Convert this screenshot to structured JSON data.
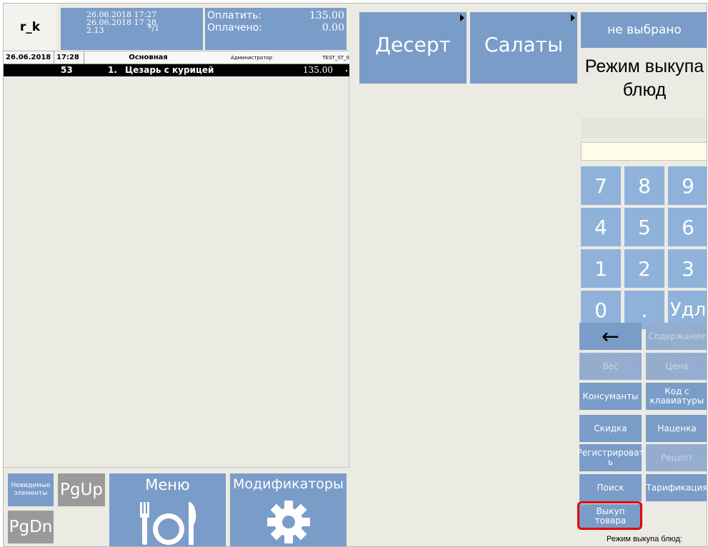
{
  "header": {
    "logo": "r_k",
    "date_open": "26.06.2018 17:27",
    "date_now": "26.06.2018 17 28",
    "version": "2.13",
    "guests": "*/1",
    "to_pay_label": "Оплатить:",
    "to_pay_value": "135.00",
    "paid_label": "Оплачено:",
    "paid_value": "0.00"
  },
  "order_header": {
    "date": "26.06.2018",
    "time": "17:28",
    "menu": "Основная",
    "user": "Администратор",
    "station": "TEST_ST_0"
  },
  "order_items": [
    {
      "code": "53",
      "num": "1.",
      "name": "Цезарь с курицей",
      "price": "135.00"
    }
  ],
  "bottom": {
    "invisible": "Невидимые элементы",
    "pgup": "PgUp",
    "pgdn": "PgDn",
    "menu": "Меню",
    "modifiers": "Модификаторы"
  },
  "categories": [
    "Десерт",
    "Салаты"
  ],
  "right": {
    "not_selected": "не выбрано",
    "mode_title": "Режим выкупа блюд",
    "input_value": "",
    "keys": [
      "7",
      "8",
      "9",
      "4",
      "5",
      "6",
      "1",
      "2",
      "3",
      "0",
      ".",
      "Удл"
    ],
    "back": "←",
    "content": "Содержание",
    "weight": "Вес",
    "price": "Цена",
    "consumers": "Консуманты",
    "code_kb": "Код с клавиатуры",
    "discount": "Скидка",
    "markup": "Наценка",
    "register": "Регистрироват ь",
    "recipe": "Рецепт",
    "search": "Поиск",
    "tariff": "Тарификация",
    "buyout": "Выкуп товара",
    "status": "Режим выкупа блюд:"
  },
  "colors": {
    "button_blue": "#7a9cc8",
    "key_blue": "#8fb2da",
    "background": "#ebeae3",
    "highlight": "#e00000"
  }
}
